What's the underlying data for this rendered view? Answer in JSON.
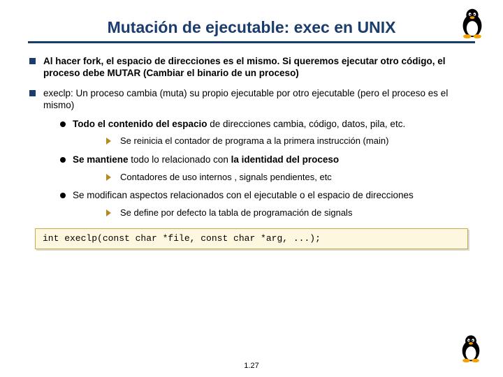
{
  "title": "Mutación de ejecutable: exec en UNIX",
  "bullets": {
    "b1_a": "Al hacer fork, el espacio de direcciones es el mismo. Si queremos ejecutar otro código, el proceso debe MUTAR (Cambiar el binario de un proceso)",
    "b2_a": "execlp: Un proceso cambia (muta) su propio ejecutable por otro ejecutable (pero el proceso es el mismo)",
    "b2_1_a": "Todo el contenido del espacio",
    "b2_1_b": " de direcciones cambia, código, datos, pila, etc.",
    "b2_1_1": "Se reinicia el contador de programa a la primera instrucción (main)",
    "b2_2_a": "Se mantiene",
    "b2_2_b": " todo lo relacionado con ",
    "b2_2_c": "la identidad del proceso",
    "b2_2_1": "Contadores de uso internos , signals pendientes, etc",
    "b2_3": "Se modifican aspectos relacionados con el ejecutable o el espacio de direcciones",
    "b2_3_1": "Se define por defecto la tabla de programación de signals"
  },
  "code": "int execlp(const char *file, const char *arg, ...);",
  "pagenum": "1.27"
}
